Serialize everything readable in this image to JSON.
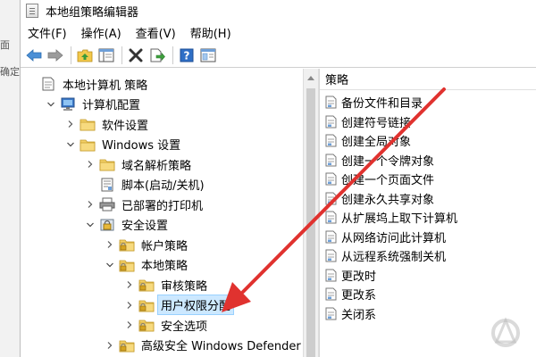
{
  "background": {
    "fragments": [
      "面",
      "确定"
    ]
  },
  "window": {
    "title": "本地组策略编辑器"
  },
  "menubar": {
    "items": [
      "文件(F)",
      "操作(A)",
      "查看(V)",
      "帮助(H)"
    ]
  },
  "toolbar": {
    "buttons": [
      "back-icon",
      "forward-icon",
      "up-folder-icon",
      "show-tree-icon",
      "delete-icon",
      "export-icon",
      "help-icon",
      "properties-icon"
    ]
  },
  "tree": {
    "items": [
      {
        "label": "本地计算机 策略",
        "depth": 0,
        "expand": "none",
        "icon": "policy-doc-icon"
      },
      {
        "label": "计算机配置",
        "depth": 1,
        "expand": "open",
        "icon": "computer-icon"
      },
      {
        "label": "软件设置",
        "depth": 2,
        "expand": "closed",
        "icon": "folder-icon"
      },
      {
        "label": "Windows 设置",
        "depth": 2,
        "expand": "open",
        "icon": "folder-icon"
      },
      {
        "label": "域名解析策略",
        "depth": 3,
        "expand": "closed",
        "icon": "folder-icon"
      },
      {
        "label": "脚本(启动/关机)",
        "depth": 3,
        "expand": "none",
        "icon": "script-icon"
      },
      {
        "label": "已部署的打印机",
        "depth": 3,
        "expand": "closed",
        "icon": "printer-icon"
      },
      {
        "label": "安全设置",
        "depth": 3,
        "expand": "open",
        "icon": "security-icon"
      },
      {
        "label": "帐户策略",
        "depth": 4,
        "expand": "closed",
        "icon": "folder-lock-icon"
      },
      {
        "label": "本地策略",
        "depth": 4,
        "expand": "open",
        "icon": "folder-lock-icon"
      },
      {
        "label": "审核策略",
        "depth": 5,
        "expand": "closed",
        "icon": "folder-lock-icon"
      },
      {
        "label": "用户权限分配",
        "depth": 5,
        "expand": "closed",
        "icon": "folder-lock-icon",
        "selected": true
      },
      {
        "label": "安全选项",
        "depth": 5,
        "expand": "closed",
        "icon": "folder-lock-icon"
      },
      {
        "label": "高级安全 Windows Defender 防",
        "depth": 4,
        "expand": "closed",
        "icon": "folder-lock-icon"
      }
    ]
  },
  "policy_pane": {
    "header": "策略",
    "items": [
      "备份文件和目录",
      "创建符号链接",
      "创建全局对象",
      "创建一个令牌对象",
      "创建一个页面文件",
      "创建永久共享对象",
      "从扩展坞上取下计算机",
      "从网络访问此计算机",
      "从远程系统强制关机",
      "更改时",
      "更改系",
      "关闭系"
    ]
  },
  "annotation": {
    "arrow_color": "#e0322f"
  }
}
